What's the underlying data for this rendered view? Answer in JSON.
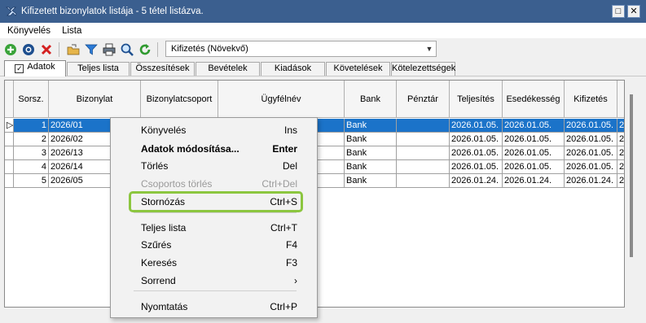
{
  "window": {
    "title": "Kifizetett bizonylatok listája - 5 tétel listázva.",
    "max_label": "□",
    "close_label": "✕"
  },
  "menu": [
    "Könyvelés",
    "Lista"
  ],
  "toolbar": {
    "sort_value": "Kifizetés (Növekvő)"
  },
  "tabs": [
    "Adatok",
    "Teljes lista",
    "Összesítések",
    "Bevételek",
    "Kiadások",
    "Követelések",
    "Kötelezettségek"
  ],
  "grid": {
    "columns": [
      "Sorsz.",
      "Bizonylat",
      "Bizonylatcsoport",
      "Ügyfélnév",
      "Bank",
      "Pénztár",
      "Teljesítés",
      "Esedékesség",
      "Kifizetés",
      ""
    ],
    "rows": [
      [
        "1",
        "2026/01",
        "",
        "",
        "Bank",
        "",
        "2026.01.05.",
        "2026.01.05.",
        "2026.01.05.",
        "2"
      ],
      [
        "2",
        "2026/02",
        "",
        "",
        "Bank",
        "",
        "2026.01.05.",
        "2026.01.05.",
        "2026.01.05.",
        "2"
      ],
      [
        "3",
        "2026/13",
        "",
        "",
        "Bank",
        "",
        "2026.01.05.",
        "2026.01.05.",
        "2026.01.05.",
        "2"
      ],
      [
        "4",
        "2026/14",
        "",
        "",
        "Bank",
        "",
        "2026.01.05.",
        "2026.01.05.",
        "2026.01.05.",
        "2"
      ],
      [
        "5",
        "2026/05",
        "",
        "",
        "Bank",
        "",
        "2026.01.24.",
        "2026.01.24.",
        "2026.01.24.",
        "2"
      ]
    ]
  },
  "context_menu": {
    "items": [
      {
        "label": "Könyvelés",
        "shortcut": "Ins"
      },
      {
        "label": "Adatok módosítása...",
        "shortcut": "Enter"
      },
      {
        "label": "Törlés",
        "shortcut": "Del"
      },
      {
        "label": "Csoportos törlés",
        "shortcut": "Ctrl+Del"
      },
      {
        "label": "Stornózás",
        "shortcut": "Ctrl+S"
      },
      {
        "label": "Teljes lista",
        "shortcut": "Ctrl+T"
      },
      {
        "label": "Szűrés",
        "shortcut": "F4"
      },
      {
        "label": "Keresés",
        "shortcut": "F3"
      },
      {
        "label": "Sorrend",
        "shortcut": "›"
      },
      {
        "label": "Nyomtatás",
        "shortcut": "Ctrl+P"
      }
    ]
  },
  "colors": {
    "titlebar": "#3b5f8f",
    "selection": "#1b73c9",
    "highlight": "#8cc63f"
  }
}
